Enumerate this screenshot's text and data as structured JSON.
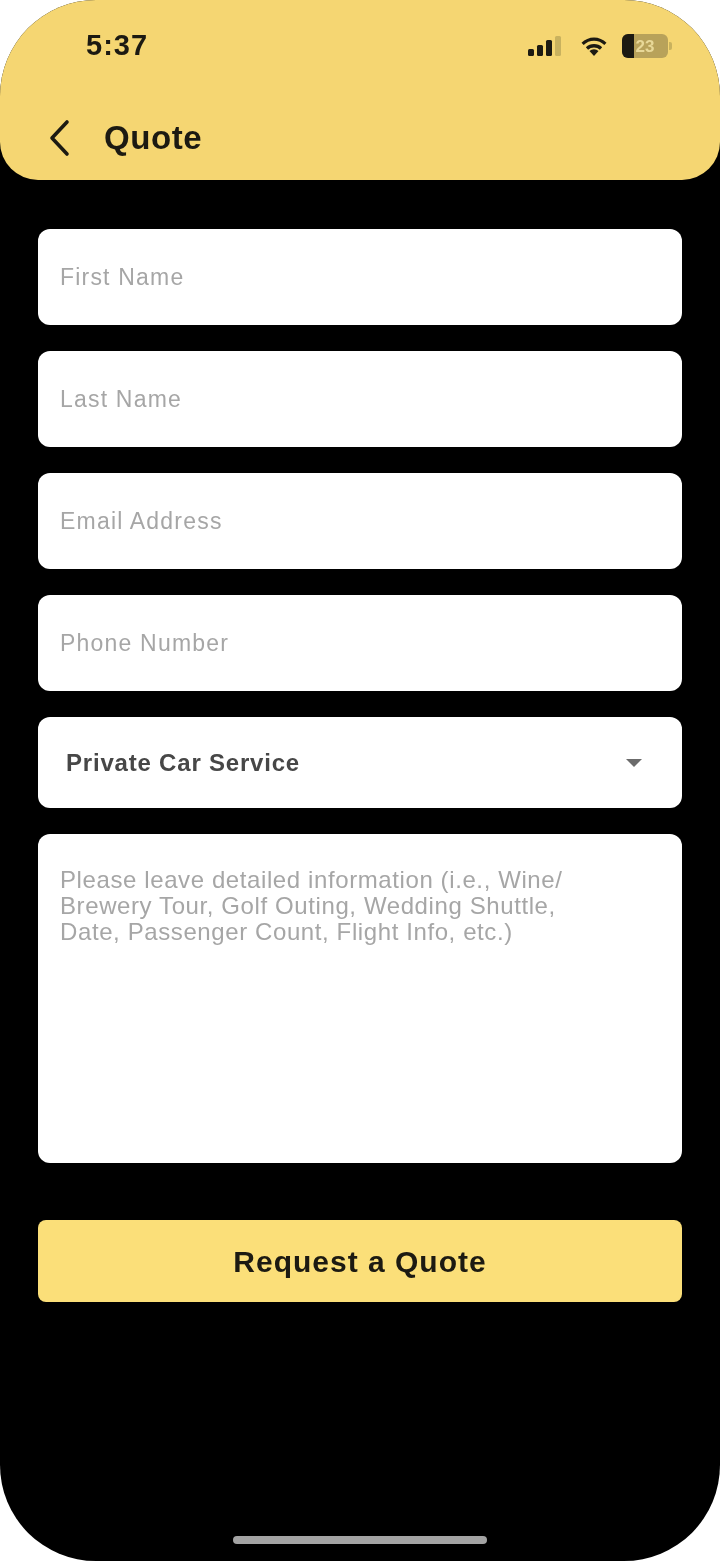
{
  "status_bar": {
    "time": "5:37",
    "battery": "23"
  },
  "header": {
    "title": "Quote"
  },
  "form": {
    "fields": [
      {
        "kind": "text",
        "placeholder": "First Name"
      },
      {
        "kind": "text",
        "placeholder": "Last Name"
      },
      {
        "kind": "text",
        "placeholder": "Email Address"
      },
      {
        "kind": "text",
        "placeholder": "Phone Number"
      },
      {
        "kind": "select",
        "value": "Private Car Service"
      },
      {
        "kind": "textarea",
        "placeholder": "Please leave detailed information (i.e., Wine/ Brewery Tour, Golf Outing, Wedding Shuttle, Date, Passenger Count, Flight Info, etc.)"
      }
    ]
  },
  "submit_button": {
    "label": "Request a Quote"
  }
}
